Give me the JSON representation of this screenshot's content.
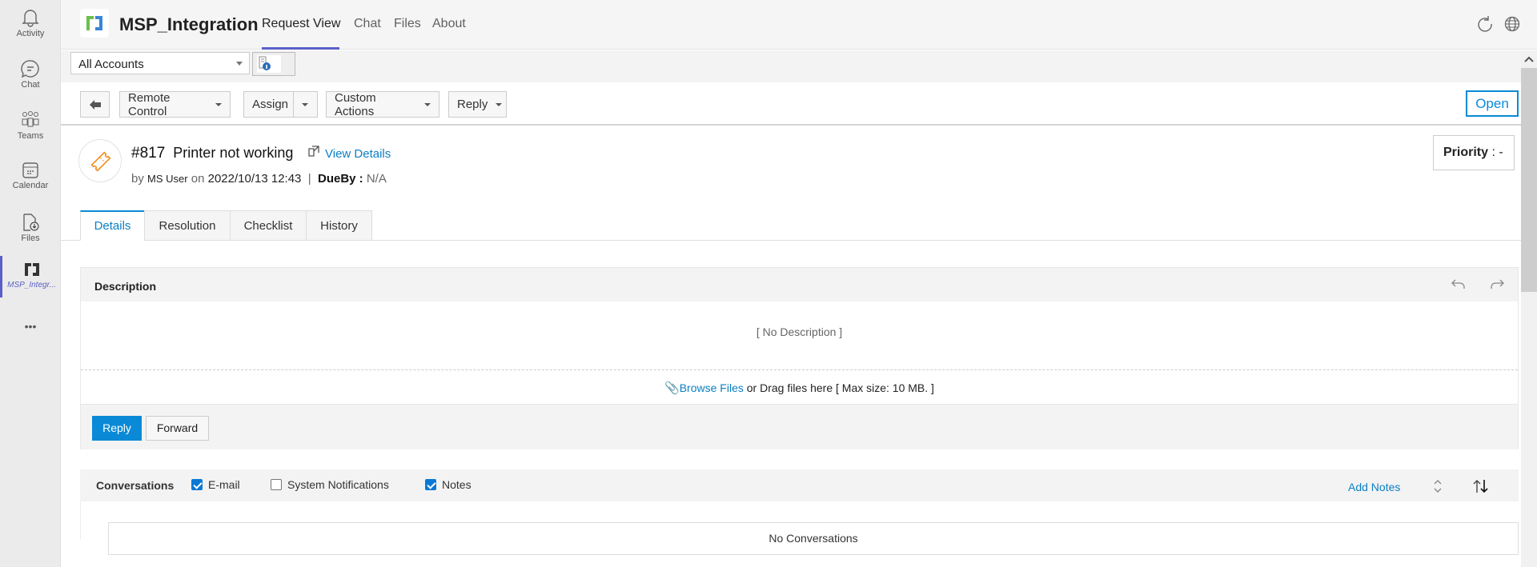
{
  "rail": [
    {
      "label": "Activity",
      "icon": "bell-icon"
    },
    {
      "label": "Chat",
      "icon": "chat-icon"
    },
    {
      "label": "Teams",
      "icon": "teams-icon"
    },
    {
      "label": "Calendar",
      "icon": "calendar-icon"
    },
    {
      "label": "Files",
      "icon": "files-icon"
    },
    {
      "label": "MSP_Integr...",
      "icon": "app-icon"
    }
  ],
  "rail_more": "•••",
  "header": {
    "title": "MSP_Integration",
    "tabs": [
      "Request View",
      "Chat",
      "Files",
      "About"
    ]
  },
  "accounts": {
    "selected": "All Accounts"
  },
  "toolbar": {
    "remote": "Remote Control",
    "assign": "Assign",
    "custom": "Custom Actions",
    "reply": "Reply",
    "status": "Open"
  },
  "ticket": {
    "id": "#817",
    "subject": "Printer not working",
    "view_details": "View Details",
    "by": "by",
    "user": "MS User",
    "on": "on",
    "date": "2022/10/13 12:43",
    "sep": "|",
    "dueby_label": "DueBy :",
    "dueby": "N/A",
    "priority_label": "Priority",
    "priority_value": " : -"
  },
  "tabs": [
    "Details",
    "Resolution",
    "Checklist",
    "History"
  ],
  "description": {
    "title": "Description",
    "empty": "[ No Description ]",
    "browse": "Browse Files",
    "drag": " or Drag files here [ Max size: 10 MB. ]",
    "reply": "Reply",
    "forward": "Forward"
  },
  "conversations": {
    "title": "Conversations",
    "email": "E-mail",
    "system": "System Notifications",
    "notes": "Notes",
    "add_notes": "Add Notes",
    "empty": "No Conversations"
  },
  "colors": {
    "accent": "#5b5fc7",
    "link": "#0b7fc4",
    "primary": "#0a8ad6"
  }
}
